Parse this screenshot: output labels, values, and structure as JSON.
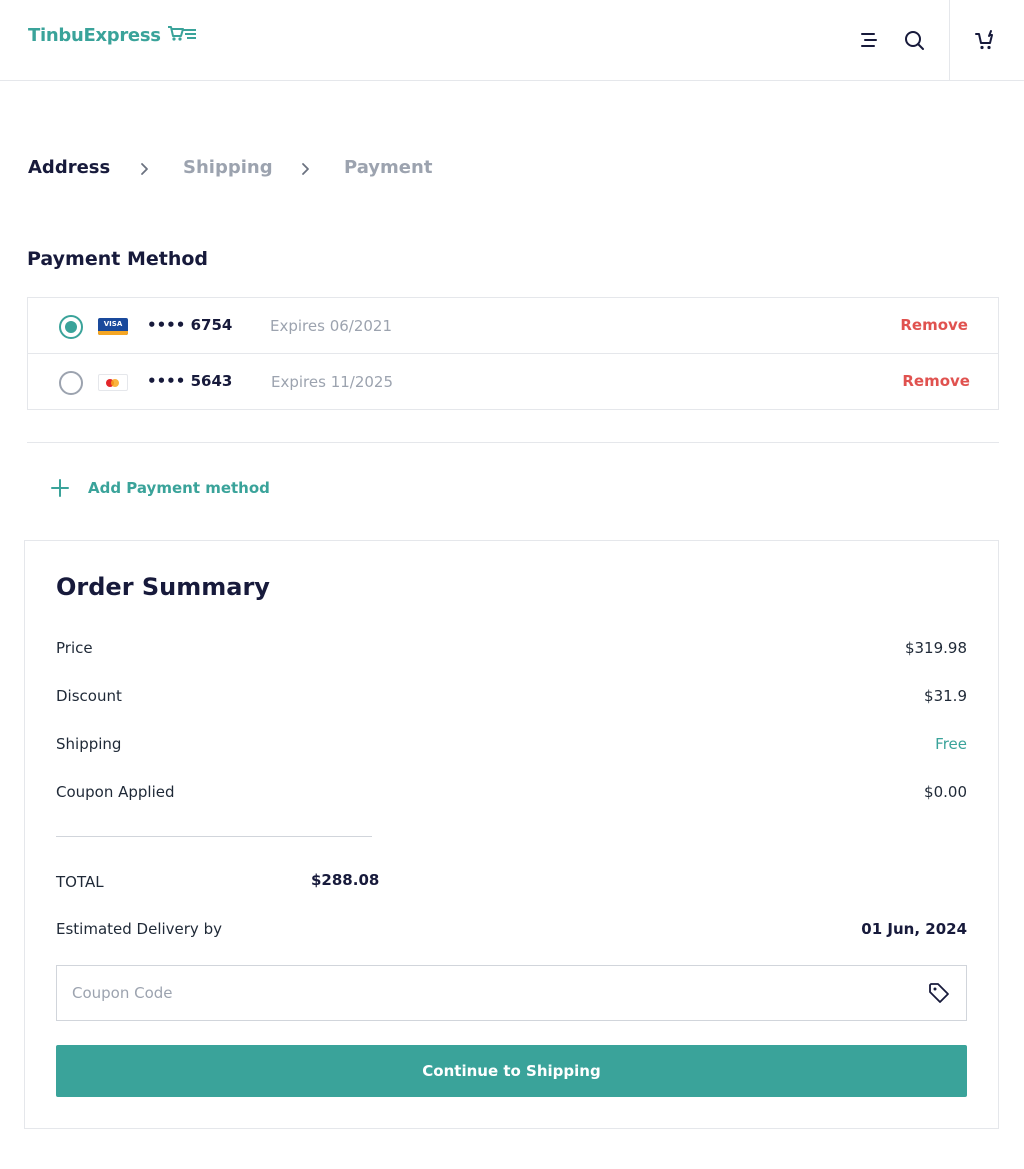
{
  "header": {
    "logo_text": "TinbuExpress",
    "icons": [
      "menu-icon",
      "search-icon",
      "cart-icon"
    ]
  },
  "steps": [
    {
      "label": "Address",
      "state": "active"
    },
    {
      "label": "Shipping",
      "state": "inactive"
    },
    {
      "label": "Payment",
      "state": "inactive"
    }
  ],
  "payment": {
    "title": "Payment Method",
    "cards": [
      {
        "brand": "visa",
        "brand_text": "VISA",
        "number": "•••• 6754",
        "expires": "Expires 06/2021",
        "remove_label": "Remove",
        "selected": true
      },
      {
        "brand": "mastercard",
        "number": "•••• 5643",
        "expires": "Expires 11/2025",
        "remove_label": "Remove",
        "selected": false
      }
    ],
    "add_label": "Add Payment method"
  },
  "summary": {
    "title": "Order Summary",
    "rows": [
      {
        "label": "Price",
        "value": "$319.98"
      },
      {
        "label": "Discount",
        "value": "$31.9"
      },
      {
        "label": "Shipping",
        "value": "Free"
      },
      {
        "label": "Coupon Applied",
        "value": "$0.00"
      }
    ],
    "total_label": "TOTAL",
    "total_value": "$288.08",
    "delivery_label": "Estimated Delivery by",
    "delivery_value": "01 Jun, 2024",
    "coupon_placeholder": "Coupon Code",
    "cta_label": "Continue to Shipping"
  },
  "colors": {
    "accent": "#3aa39a",
    "danger": "#e0524f",
    "heading": "#171a3b",
    "muted": "#9ca3af",
    "border": "#e5e7eb"
  }
}
